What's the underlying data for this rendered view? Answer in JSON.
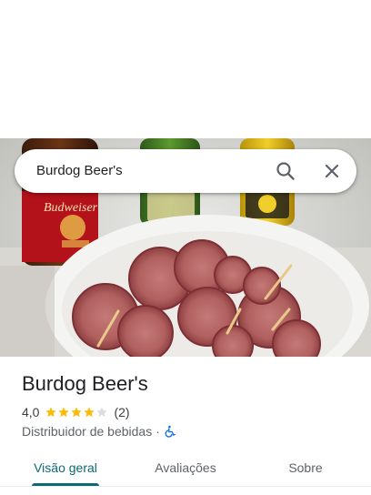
{
  "search": {
    "query": "Burdog Beer's",
    "search_icon": "search-icon",
    "close_icon": "close-icon"
  },
  "photo": {
    "bottle_label_text": "Budweiser"
  },
  "place": {
    "name": "Burdog Beer's",
    "rating": "4,0",
    "stars": 4,
    "stars_max": 5,
    "review_count": "(2)",
    "category": "Distribuidor de bebidas",
    "separator": "·",
    "accessibility_icon": "wheelchair-icon"
  },
  "tabs": [
    {
      "label": "Visão geral",
      "active": true
    },
    {
      "label": "Avaliações",
      "active": false
    },
    {
      "label": "Sobre",
      "active": false
    }
  ],
  "colors": {
    "accent": "#0b6a73",
    "star": "#fbbc04",
    "star_empty": "#dadce0",
    "access": "#1a73e8"
  }
}
